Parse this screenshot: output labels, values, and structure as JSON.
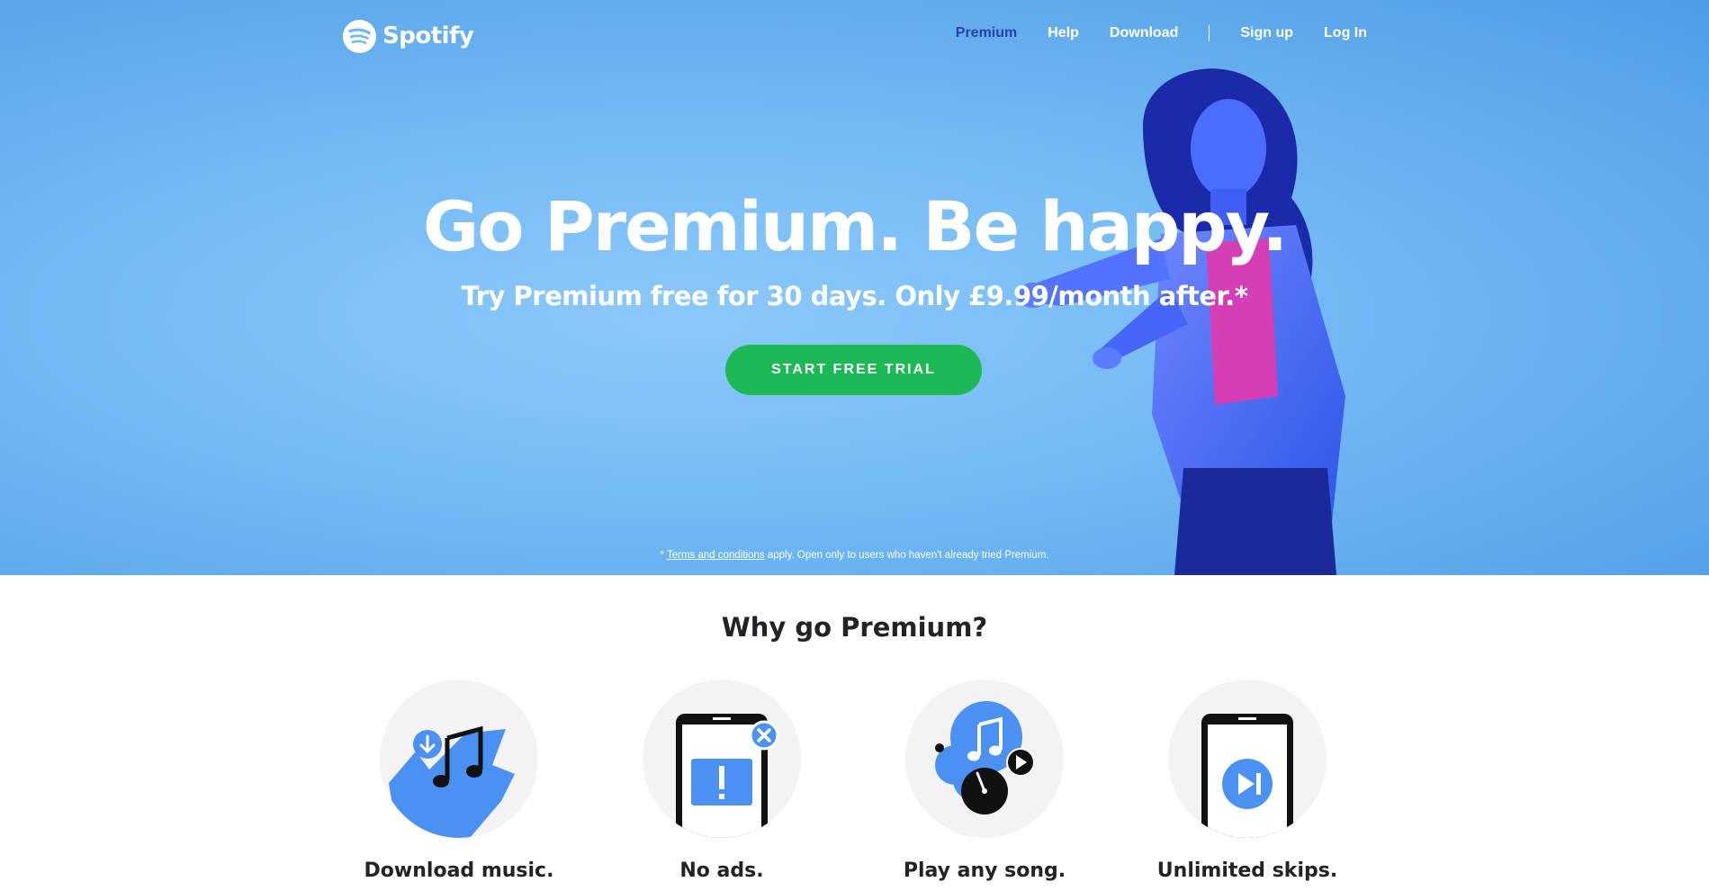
{
  "brand": {
    "name": "Spotify",
    "accent_green": "#1db954",
    "accent_blue": "#4b91f1"
  },
  "nav": {
    "premium": "Premium",
    "help": "Help",
    "download": "Download",
    "sign_up": "Sign up",
    "log_in": "Log In"
  },
  "hero": {
    "title": "Go Premium. Be happy.",
    "subtitle": "Try Premium free for 30 days. Only £9.99/month after.*",
    "cta": "START FREE TRIAL",
    "terms_prefix": "* ",
    "terms_link": "Terms and conditions",
    "terms_suffix": " apply. Open only to users who haven't already tried Premium."
  },
  "why": {
    "title": "Why go Premium?",
    "features": [
      {
        "label": "Download music.",
        "icon": "download-music-icon"
      },
      {
        "label": "No ads.",
        "icon": "no-ads-icon"
      },
      {
        "label": "Play any song.",
        "icon": "play-any-song-icon"
      },
      {
        "label": "Unlimited skips.",
        "icon": "unlimited-skips-icon"
      }
    ]
  }
}
